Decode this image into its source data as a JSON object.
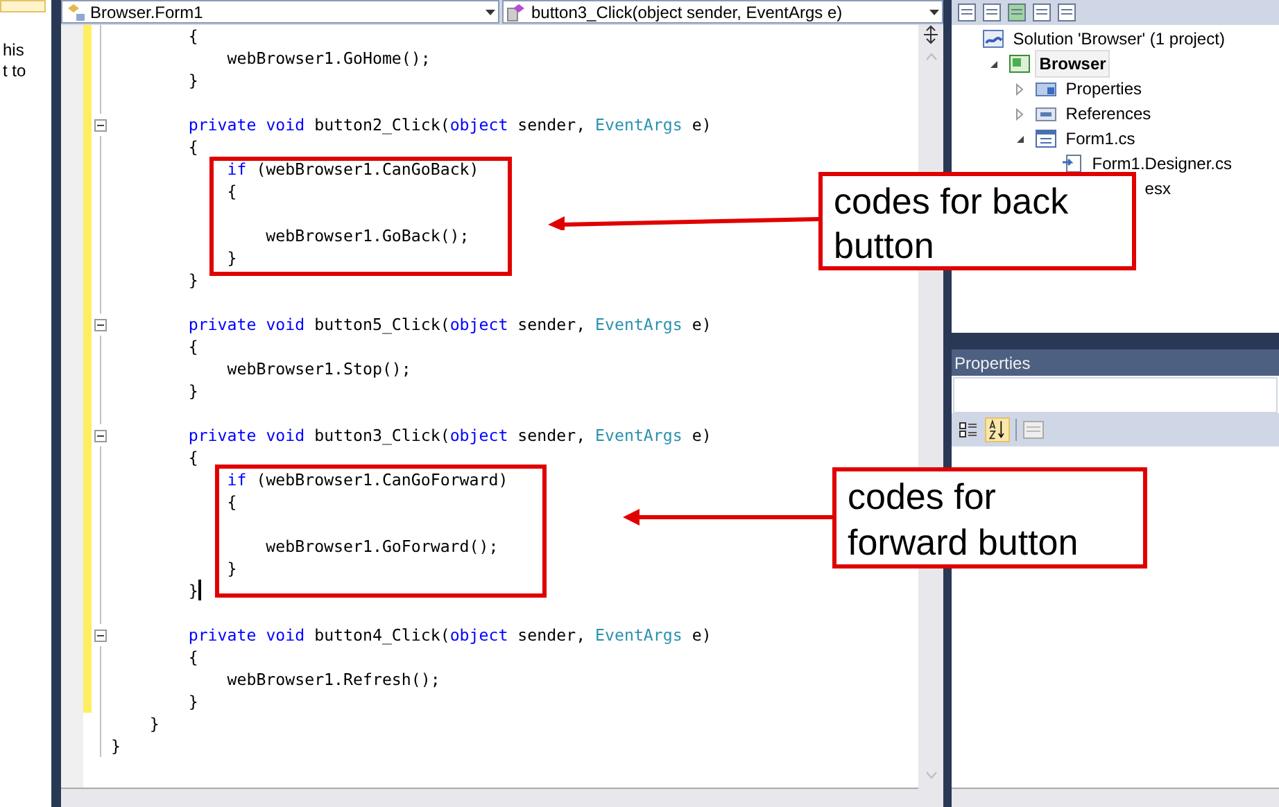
{
  "left_panel": {
    "texts": [
      "his",
      "t to"
    ]
  },
  "editor": {
    "class_dropdown": "Browser.Form1",
    "member_dropdown": "button3_Click(object sender, EventArgs e)",
    "lines": [
      {
        "changed": true,
        "segments": [
          {
            "text": "        {",
            "kind": "plain"
          }
        ]
      },
      {
        "changed": true,
        "segments": [
          {
            "text": "            webBrowser1.GoHome();",
            "kind": "plain"
          }
        ]
      },
      {
        "changed": true,
        "segments": [
          {
            "text": "        }",
            "kind": "plain"
          }
        ]
      },
      {
        "changed": true
      },
      {
        "changed": true,
        "outline": true,
        "segments": [
          {
            "text": "        private ",
            "kind": "keyword"
          },
          {
            "text": "void",
            "kind": "keyword"
          },
          {
            "text": " button2_Click(",
            "kind": "plain"
          },
          {
            "text": "object",
            "kind": "keyword"
          },
          {
            "text": " sender, ",
            "kind": "plain"
          },
          {
            "text": "EventArgs",
            "kind": "type"
          },
          {
            "text": " e)",
            "kind": "plain"
          }
        ]
      },
      {
        "changed": true,
        "segments": [
          {
            "text": "        {",
            "kind": "plain"
          }
        ]
      },
      {
        "changed": true,
        "segments": [
          {
            "text": "            if",
            "kind": "keyword"
          },
          {
            "text": " (webBrowser1.CanGoBack)",
            "kind": "plain"
          }
        ]
      },
      {
        "changed": true,
        "segments": [
          {
            "text": "            {",
            "kind": "plain"
          }
        ]
      },
      {
        "changed": true
      },
      {
        "changed": true,
        "segments": [
          {
            "text": "                webBrowser1.GoBack();",
            "kind": "plain"
          }
        ]
      },
      {
        "changed": true,
        "segments": [
          {
            "text": "            }",
            "kind": "plain"
          }
        ]
      },
      {
        "changed": true,
        "segments": [
          {
            "text": "        }",
            "kind": "plain"
          }
        ]
      },
      {
        "changed": true
      },
      {
        "changed": true,
        "outline": true,
        "segments": [
          {
            "text": "        private ",
            "kind": "keyword"
          },
          {
            "text": "void",
            "kind": "keyword"
          },
          {
            "text": " button5_Click(",
            "kind": "plain"
          },
          {
            "text": "object",
            "kind": "keyword"
          },
          {
            "text": " sender, ",
            "kind": "plain"
          },
          {
            "text": "EventArgs",
            "kind": "type"
          },
          {
            "text": " e)",
            "kind": "plain"
          }
        ]
      },
      {
        "changed": true,
        "segments": [
          {
            "text": "        {",
            "kind": "plain"
          }
        ]
      },
      {
        "changed": true,
        "segments": [
          {
            "text": "            webBrowser1.Stop();",
            "kind": "plain"
          }
        ]
      },
      {
        "changed": true,
        "segments": [
          {
            "text": "        }",
            "kind": "plain"
          }
        ]
      },
      {
        "changed": true
      },
      {
        "changed": true,
        "outline": true,
        "segments": [
          {
            "text": "        private ",
            "kind": "keyword"
          },
          {
            "text": "void",
            "kind": "keyword"
          },
          {
            "text": " button3_Click(",
            "kind": "plain"
          },
          {
            "text": "object",
            "kind": "keyword"
          },
          {
            "text": " sender, ",
            "kind": "plain"
          },
          {
            "text": "EventArgs",
            "kind": "type"
          },
          {
            "text": " e)",
            "kind": "plain"
          }
        ]
      },
      {
        "changed": true,
        "segments": [
          {
            "text": "        {",
            "kind": "plain"
          }
        ]
      },
      {
        "changed": true,
        "segments": [
          {
            "text": "            if",
            "kind": "keyword"
          },
          {
            "text": " (webBrowser1.CanGoForward)",
            "kind": "plain"
          }
        ]
      },
      {
        "changed": true,
        "segments": [
          {
            "text": "            {",
            "kind": "plain"
          }
        ]
      },
      {
        "changed": true
      },
      {
        "changed": true,
        "segments": [
          {
            "text": "                webBrowser1.GoForward();",
            "kind": "plain"
          }
        ]
      },
      {
        "changed": true,
        "segments": [
          {
            "text": "            }",
            "kind": "plain"
          }
        ]
      },
      {
        "changed": true,
        "cursor": true,
        "segments": [
          {
            "text": "        }",
            "kind": "plain"
          }
        ]
      },
      {
        "changed": true
      },
      {
        "changed": true,
        "outline": true,
        "segments": [
          {
            "text": "        private ",
            "kind": "keyword"
          },
          {
            "text": "void",
            "kind": "keyword"
          },
          {
            "text": " button4_Click(",
            "kind": "plain"
          },
          {
            "text": "object",
            "kind": "keyword"
          },
          {
            "text": " sender, ",
            "kind": "plain"
          },
          {
            "text": "EventArgs",
            "kind": "type"
          },
          {
            "text": " e)",
            "kind": "plain"
          }
        ]
      },
      {
        "changed": true,
        "segments": [
          {
            "text": "        {",
            "kind": "plain"
          }
        ]
      },
      {
        "changed": true,
        "segments": [
          {
            "text": "            webBrowser1.Refresh();",
            "kind": "plain"
          }
        ]
      },
      {
        "changed": true,
        "segments": [
          {
            "text": "        }",
            "kind": "plain"
          }
        ]
      },
      {
        "changed": false,
        "segments": [
          {
            "text": "    }",
            "kind": "plain"
          }
        ]
      },
      {
        "changed": false,
        "segments": [
          {
            "text": "}",
            "kind": "plain"
          }
        ]
      }
    ]
  },
  "annotations": [
    {
      "text": "codes for back button"
    },
    {
      "text": "codes for forward button"
    }
  ],
  "solution_explorer": {
    "tree": [
      {
        "label": "Solution 'Browser' (1 project)",
        "kind": "solution",
        "children": [
          {
            "label": "Browser",
            "kind": "project",
            "expanded": true,
            "selected": true,
            "children": [
              {
                "label": "Properties",
                "kind": "properties",
                "expanded": false
              },
              {
                "label": "References",
                "kind": "references",
                "expanded": false
              },
              {
                "label": "Form1.cs",
                "kind": "form",
                "expanded": true,
                "children": [
                  {
                    "label": "Form1.Designer.cs",
                    "kind": "file"
                  },
                  {
                    "label": "esx",
                    "kind": "hidden"
                  }
                ]
              }
            ]
          }
        ]
      }
    ]
  },
  "properties": {
    "title": "Properties",
    "sort_alphabetical": true
  }
}
